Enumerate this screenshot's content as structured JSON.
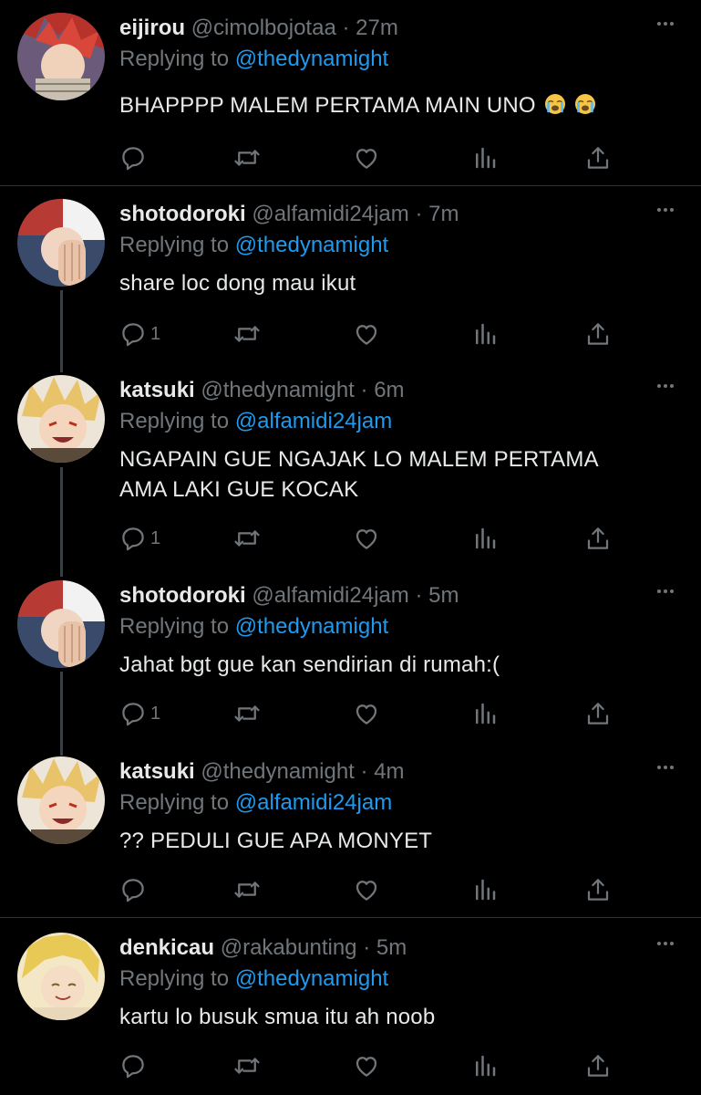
{
  "tweets": [
    {
      "name": "eijirou",
      "handle": "@cimolbojotaa",
      "time": "27m",
      "sep": "·",
      "replying": "Replying to",
      "mention": "@thedynamight",
      "text": "BHAPPPP MALEM PERTAMA MAIN UNO",
      "emojis": [
        "loudly-crying-face",
        "loudly-crying-face"
      ],
      "replies": "",
      "avatar": "red-spiky-hair"
    },
    {
      "name": "shotodoroki",
      "handle": "@alfamidi24jam",
      "time": "7m",
      "sep": "·",
      "replying": "Replying to",
      "mention": "@thedynamight",
      "text": "share loc dong mau ikut",
      "replies": "1",
      "avatar": "red-white-hair"
    },
    {
      "name": "katsuki",
      "handle": "@thedynamight",
      "time": "6m",
      "sep": "·",
      "replying": "Replying to",
      "mention": "@alfamidi24jam",
      "text": "NGAPAIN GUE NGAJAK LO MALEM PERTAMA AMA LAKI GUE KOCAK",
      "replies": "1",
      "avatar": "blond-spiky-hair"
    },
    {
      "name": "shotodoroki",
      "handle": "@alfamidi24jam",
      "time": "5m",
      "sep": "·",
      "replying": "Replying to",
      "mention": "@thedynamight",
      "text": "Jahat bgt gue kan sendirian di rumah:(",
      "replies": "1",
      "avatar": "red-white-hair"
    },
    {
      "name": "katsuki",
      "handle": "@thedynamight",
      "time": "4m",
      "sep": "·",
      "replying": "Replying to",
      "mention": "@alfamidi24jam",
      "text": "?? PEDULI GUE APA MONYET",
      "replies": "",
      "avatar": "blond-spiky-hair"
    },
    {
      "name": "denkicau",
      "handle": "@rakabunting",
      "time": "5m",
      "sep": "·",
      "replying": "Replying to",
      "mention": "@thedynamight",
      "text": "kartu lo busuk smua itu ah noob",
      "replies": "",
      "avatar": "yellow-hair"
    }
  ],
  "icons": {
    "reply": "reply-icon",
    "retweet": "retweet-icon",
    "like": "like-icon",
    "views": "views-icon",
    "share": "share-icon",
    "more": "more-icon"
  },
  "colors": {
    "background": "#000000",
    "text": "#e7e9ea",
    "secondary": "#71767b",
    "link": "#1d9bf0",
    "divider": "#2f3336"
  }
}
